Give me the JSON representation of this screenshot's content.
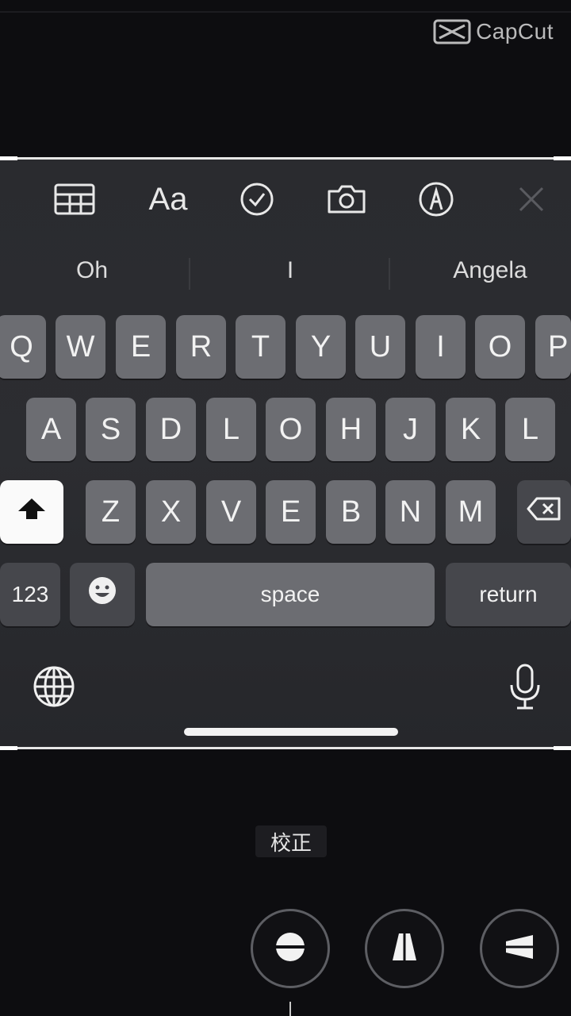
{
  "watermark": {
    "text": "CapCut"
  },
  "toolbar": {
    "items": [
      {
        "icon": "table-icon"
      },
      {
        "label": "Aa",
        "icon": "text-format-icon"
      },
      {
        "icon": "checklist-icon"
      },
      {
        "icon": "camera-icon"
      },
      {
        "icon": "markup-pen-icon"
      },
      {
        "icon": "close-icon"
      }
    ]
  },
  "suggestions": [
    "Oh",
    "I",
    "Angela"
  ],
  "keyboard": {
    "row1": [
      "Q",
      "W",
      "E",
      "R",
      "T",
      "Y",
      "U",
      "I",
      "O",
      "P"
    ],
    "row2": [
      "A",
      "S",
      "D",
      "L",
      "O",
      "H",
      "J",
      "K",
      "L"
    ],
    "row3": [
      "Z",
      "X",
      "V",
      "E",
      "B",
      "N",
      "M"
    ],
    "numbers_label": "123",
    "space_label": "space",
    "return_label": "return"
  },
  "edit_panel": {
    "label": "校正",
    "buttons": [
      "level-horizon-icon",
      "vertical-perspective-icon",
      "horizontal-perspective-icon"
    ]
  },
  "colors": {
    "key": "#6c6d72",
    "shift_active": "#fafafa",
    "background": "#0d0d10"
  }
}
